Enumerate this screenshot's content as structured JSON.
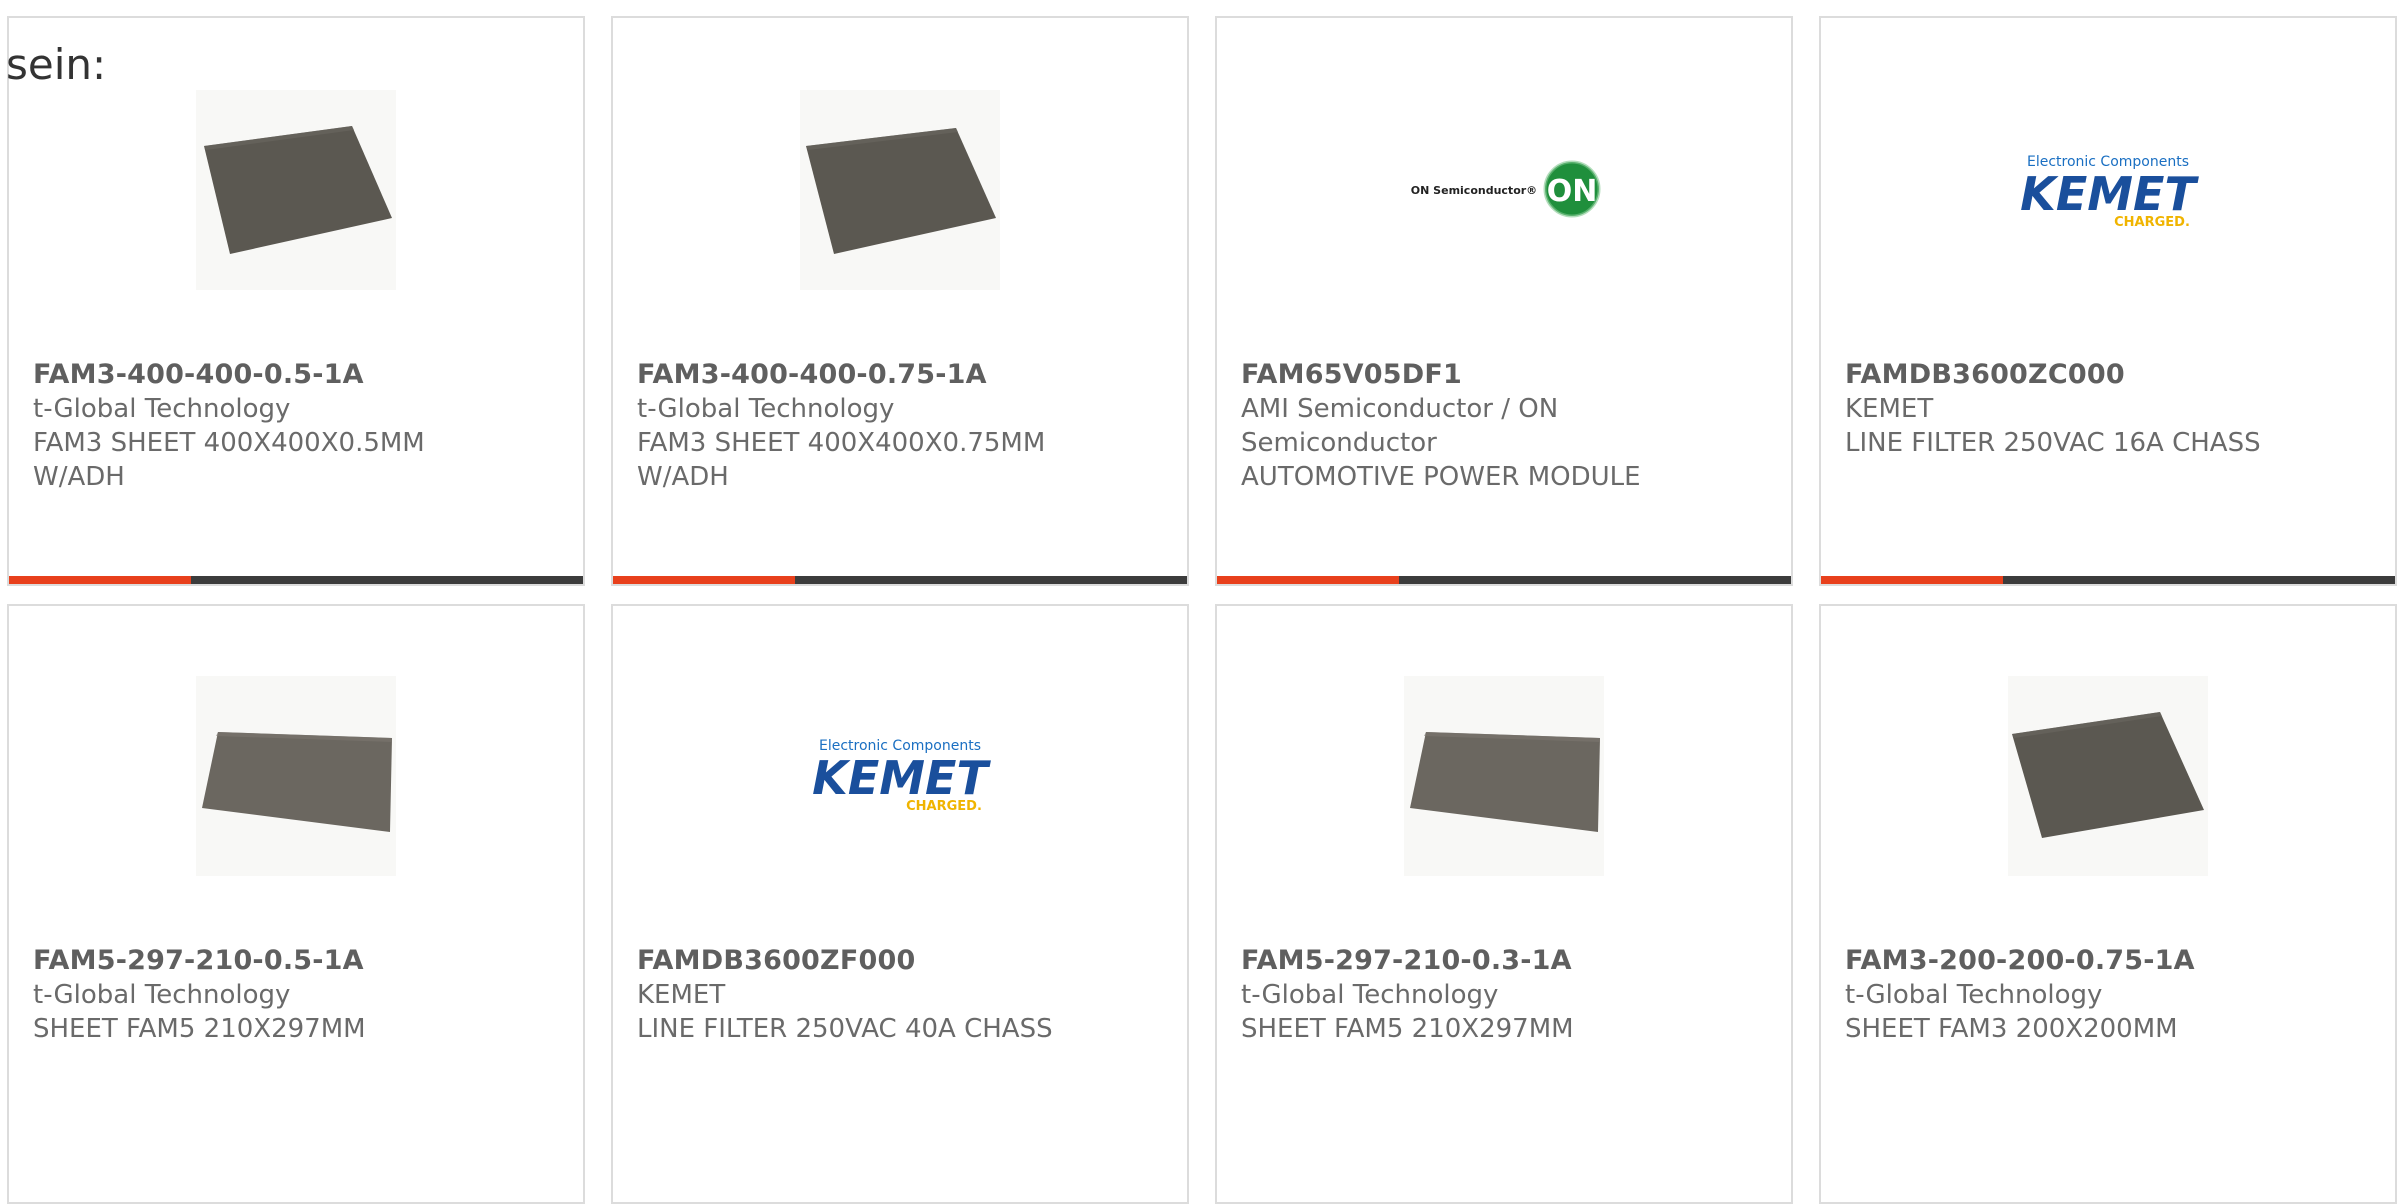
{
  "intro_text": "sein:",
  "colors": {
    "accent": "#e8401c",
    "bar_dark": "#3c3c3c",
    "card_border": "#dcdcdc",
    "text": "#6a6a6a"
  },
  "products": [
    {
      "part_number": "FAM3-400-400-0.5-1A",
      "manufacturer": "t-Global Technology",
      "description_lines": [
        "FAM3 SHEET 400X400X0.5MM",
        "W/ADH"
      ],
      "image": "thermal-sheet-image"
    },
    {
      "part_number": "FAM3-400-400-0.75-1A",
      "manufacturer": "t-Global Technology",
      "description_lines": [
        "FAM3 SHEET 400X400X0.75MM",
        "W/ADH"
      ],
      "image": "thermal-sheet-image"
    },
    {
      "part_number": "FAM65V05DF1",
      "manufacturer_lines": [
        "AMI Semiconductor / ON",
        "Semiconductor"
      ],
      "description_lines": [
        "AUTOMOTIVE POWER MODULE"
      ],
      "image": "on-semiconductor-logo",
      "logo_text": "ON Semiconductor®",
      "logo_badge": "ON"
    },
    {
      "part_number": "FAMDB3600ZC000",
      "manufacturer": "KEMET",
      "description_lines": [
        "LINE FILTER 250VAC 16A CHASS"
      ],
      "image": "kemet-logo",
      "logo_top": "Electronic Components",
      "logo_main": "KEMET",
      "logo_bottom": "CHARGED."
    },
    {
      "part_number": "FAM5-297-210-0.5-1A",
      "manufacturer": "t-Global Technology",
      "description_lines": [
        "SHEET FAM5 210X297MM"
      ],
      "image": "thermal-sheet-image"
    },
    {
      "part_number": "FAMDB3600ZF000",
      "manufacturer": "KEMET",
      "description_lines": [
        "LINE FILTER 250VAC 40A CHASS"
      ],
      "image": "kemet-logo",
      "logo_top": "Electronic Components",
      "logo_main": "KEMET",
      "logo_bottom": "CHARGED."
    },
    {
      "part_number": "FAM5-297-210-0.3-1A",
      "manufacturer": "t-Global Technology",
      "description_lines": [
        "SHEET FAM5 210X297MM"
      ],
      "image": "thermal-sheet-image"
    },
    {
      "part_number": "FAM3-200-200-0.75-1A",
      "manufacturer": "t-Global Technology",
      "description_lines": [
        "SHEET FAM3 200X200MM"
      ],
      "image": "thermal-sheet-image"
    }
  ]
}
